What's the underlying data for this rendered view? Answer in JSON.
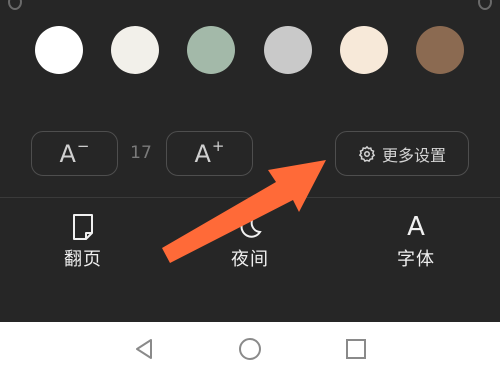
{
  "colors": {
    "panel_bg": "#262626",
    "swatches": [
      "#ffffff",
      "#f2f0ea",
      "#a3b9a9",
      "#c9c9c9",
      "#f7e9d9",
      "#8b6a51"
    ],
    "arrow": "#ff6a38"
  },
  "font_size": {
    "decrease_label": "A",
    "decrease_sign": "−",
    "value": "17",
    "increase_label": "A",
    "increase_sign": "+"
  },
  "more_settings": {
    "icon": "gear-icon",
    "label": "更多设置"
  },
  "toolbar": {
    "page_turn": {
      "icon": "page-icon",
      "label": "翻页"
    },
    "night": {
      "icon": "moon-icon",
      "label": "夜间"
    },
    "font": {
      "glyph": "A",
      "label": "字体"
    }
  },
  "navbar": {
    "back_icon": "back-triangle-icon",
    "home_icon": "home-circle-icon",
    "recent_icon": "recent-square-icon"
  }
}
